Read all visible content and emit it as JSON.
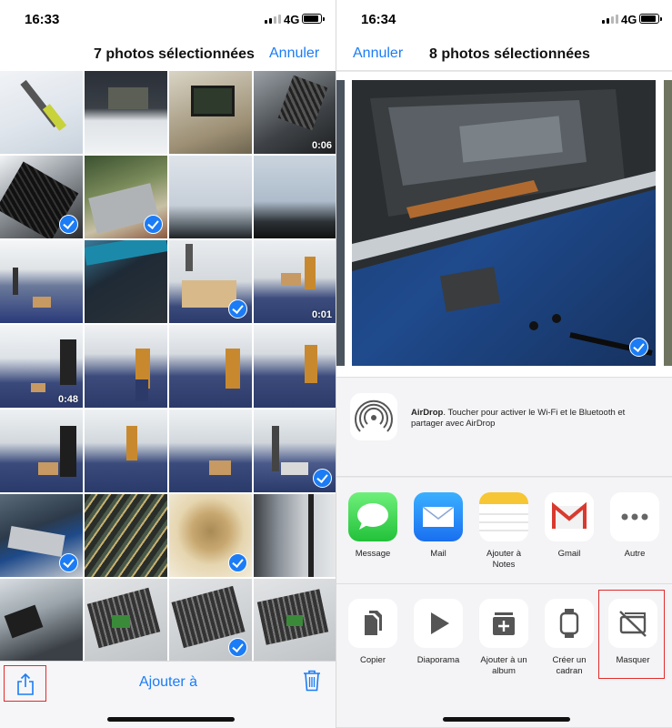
{
  "left": {
    "time": "16:33",
    "network": "4G",
    "title": "7 photos sélectionnées",
    "cancel": "Annuler",
    "durations": {
      "t3": "0:06",
      "t11": "0:01",
      "t15": "0:48"
    },
    "toolbar": {
      "add": "Ajouter à"
    }
  },
  "right": {
    "time": "16:34",
    "network": "4G",
    "title": "8 photos sélectionnées",
    "cancel": "Annuler",
    "airdrop": {
      "name": "AirDrop",
      "text": ". Toucher pour activer le Wi-Fi et le Bluetooth et partager avec AirDrop"
    },
    "apps": [
      {
        "label": "Message",
        "icon": "messages-icon"
      },
      {
        "label": "Mail",
        "icon": "mail-icon"
      },
      {
        "label": "Ajouter à Notes",
        "icon": "notes-icon"
      },
      {
        "label": "Gmail",
        "icon": "gmail-icon"
      },
      {
        "label": "Autre",
        "icon": "more-icon"
      }
    ],
    "actions": [
      {
        "label": "Copier",
        "icon": "copy-icon"
      },
      {
        "label": "Diaporama",
        "icon": "play-icon"
      },
      {
        "label": "Ajouter à un album",
        "icon": "add-album-icon"
      },
      {
        "label": "Créer un cadran",
        "icon": "watch-icon"
      },
      {
        "label": "Masquer",
        "icon": "hide-icon"
      }
    ]
  },
  "colors": {
    "accent": "#1b7cf6",
    "highlight": "#e22a2a"
  }
}
